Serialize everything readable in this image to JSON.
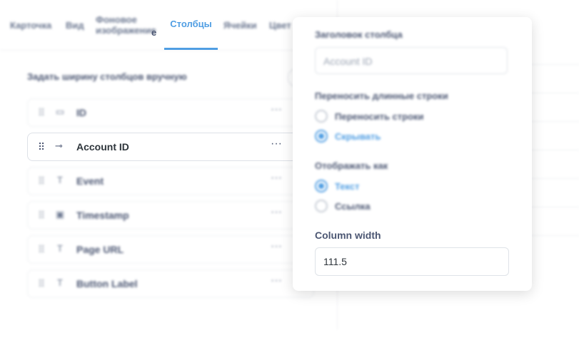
{
  "tabs": [
    "Карточка",
    "Вид",
    "Фоновое изображение",
    "Столбцы",
    "Ячейки",
    "Цвет"
  ],
  "active_tab": "Столбцы",
  "active_tab_overflow_char": "е",
  "section_label": "Задать ширину столбцов вручную",
  "columns": [
    {
      "name": "ID",
      "icon": "tag-icon"
    },
    {
      "name": "Account ID",
      "icon": "key-icon"
    },
    {
      "name": "Event",
      "icon": "text-icon"
    },
    {
      "name": "Timestamp",
      "icon": "calendar-icon"
    },
    {
      "name": "Page URL",
      "icon": "text-icon"
    },
    {
      "name": "Button Label",
      "icon": "text-icon"
    }
  ],
  "popover": {
    "header_label": "Заголовок столбца",
    "header_placeholder": "Account ID",
    "wrap_label": "Переносить длинные строки",
    "wrap_options": [
      "Переносить строки",
      "Скрывать"
    ],
    "wrap_selected": "Скрывать",
    "display_label": "Отображать как",
    "display_options": [
      "Текст",
      "Ссылка"
    ],
    "display_selected": "Текст",
    "column_width_label": "Column width",
    "column_width_value": "111.5"
  },
  "colors": {
    "accent": "#509ee3",
    "text": "#4c5773",
    "border": "#dfe3e8"
  }
}
